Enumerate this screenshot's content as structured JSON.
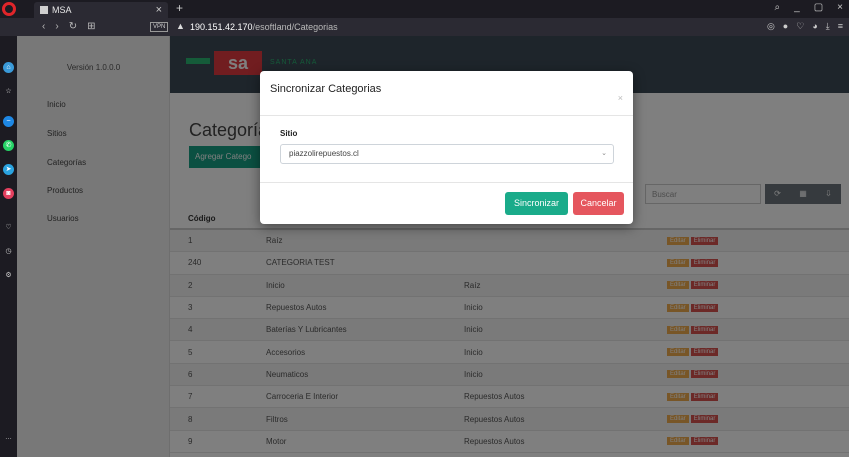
{
  "browser": {
    "tab_title": "MSA",
    "tab_close": "×",
    "new_tab": "+",
    "url_host": "190.151.42.170",
    "url_path": "/esoftland/Categorias",
    "vpn_badge": "VPN",
    "win_min": "_",
    "win_max": "▢",
    "win_close": "×"
  },
  "sidebar": {
    "version": "Versión 1.0.0.0",
    "items": [
      {
        "label": "Inicio"
      },
      {
        "label": "Sitios"
      },
      {
        "label": "Categorías"
      },
      {
        "label": "Productos"
      },
      {
        "label": "Usuarios"
      }
    ]
  },
  "header": {
    "logo": "sa",
    "logo_text": "SANTA ANA"
  },
  "main": {
    "title": "Categorías",
    "add_button": "Agregar Catego",
    "search_placeholder": "Buscar",
    "table": {
      "headers": [
        "Código"
      ],
      "rows": [
        {
          "code": "1",
          "name": "Raíz",
          "parent": ""
        },
        {
          "code": "240",
          "name": "CATEGORIA TEST",
          "parent": ""
        },
        {
          "code": "2",
          "name": "Inicio",
          "parent": "Raíz"
        },
        {
          "code": "3",
          "name": "Repuestos Autos",
          "parent": "Inicio"
        },
        {
          "code": "4",
          "name": "Baterías Y Lubricantes",
          "parent": "Inicio"
        },
        {
          "code": "5",
          "name": "Accesorios",
          "parent": "Inicio"
        },
        {
          "code": "6",
          "name": "Neumaticos",
          "parent": "Inicio"
        },
        {
          "code": "7",
          "name": "Carroceria E Interior",
          "parent": "Repuestos Autos"
        },
        {
          "code": "8",
          "name": "Filtros",
          "parent": "Repuestos Autos"
        },
        {
          "code": "9",
          "name": "Motor",
          "parent": "Repuestos Autos"
        }
      ],
      "edit_label": "Editar",
      "delete_label": "Eliminar"
    }
  },
  "modal": {
    "title": "Sincronizar Categorias",
    "close": "×",
    "field_label": "Sitio",
    "selected_site": "piazzolirepuestos.cl",
    "sync_button": "Sincronizar",
    "cancel_button": "Cancelar"
  },
  "colors": {
    "accent_green": "#1aab8a",
    "cancel_red": "#e5565e",
    "header_dark": "#3d4a57"
  }
}
